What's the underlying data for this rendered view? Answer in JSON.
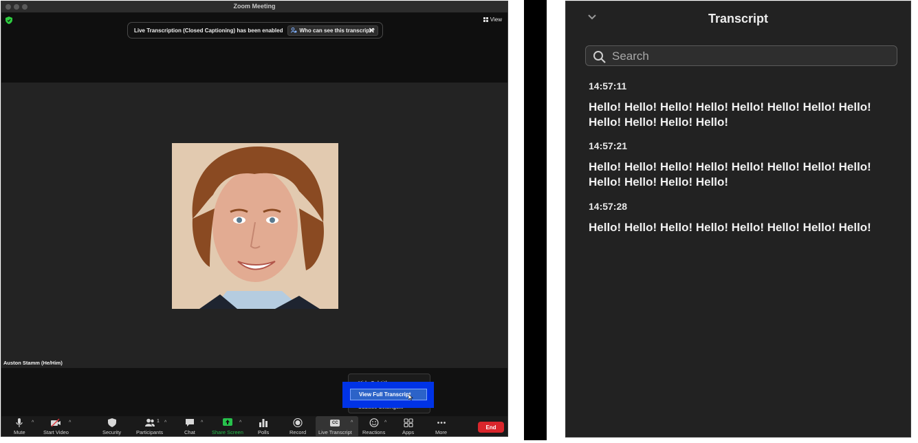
{
  "window": {
    "title": "Zoom Meeting",
    "view_label": "View"
  },
  "notice": {
    "text": "Live Transcription (Closed Captioning) has been enabled",
    "who_button": "Who can see this transcript?",
    "close_glyph": "✕"
  },
  "participant": {
    "name": "Auston Stamm (He/Him)"
  },
  "cc_menu": {
    "items": [
      "Hide Subtitle",
      "View Full Transcript",
      "Subtitle Settings..."
    ]
  },
  "toolbar": {
    "buttons": [
      {
        "label": "Mute",
        "icon": "microphone-icon"
      },
      {
        "label": "Start Video",
        "icon": "video-off-icon"
      },
      {
        "label": "Security",
        "icon": "shield-icon"
      },
      {
        "label": "Participants",
        "icon": "participants-icon",
        "count": "1"
      },
      {
        "label": "Chat",
        "icon": "chat-icon"
      },
      {
        "label": "Share Screen",
        "icon": "share-screen-icon"
      },
      {
        "label": "Polls",
        "icon": "polls-icon"
      },
      {
        "label": "Record",
        "icon": "record-icon"
      },
      {
        "label": "Live Transcript",
        "icon": "cc-icon",
        "icon_text": "CC"
      },
      {
        "label": "Reactions",
        "icon": "reactions-icon"
      },
      {
        "label": "Apps",
        "icon": "apps-icon"
      },
      {
        "label": "More",
        "icon": "more-icon"
      }
    ],
    "end_label": "End",
    "caret": "^"
  },
  "transcript": {
    "title": "Transcript",
    "search_placeholder": "Search",
    "entries": [
      {
        "time": "14:57:11",
        "text": "Hello! Hello! Hello! Hello! Hello! Hello! Hello! Hello! Hello! Hello! Hello! Hello!"
      },
      {
        "time": "14:57:21",
        "text": "Hello! Hello! Hello! Hello! Hello! Hello! Hello! Hello! Hello! Hello! Hello! Hello!"
      },
      {
        "time": "14:57:28",
        "text": "Hello! Hello! Hello! Hello! Hello! Hello! Hello! Hello!"
      }
    ]
  },
  "colors": {
    "share_green": "#27c24c",
    "end_red": "#d9262c",
    "highlight_blue": "#0033e6",
    "menu_selected": "#2c63c8"
  }
}
